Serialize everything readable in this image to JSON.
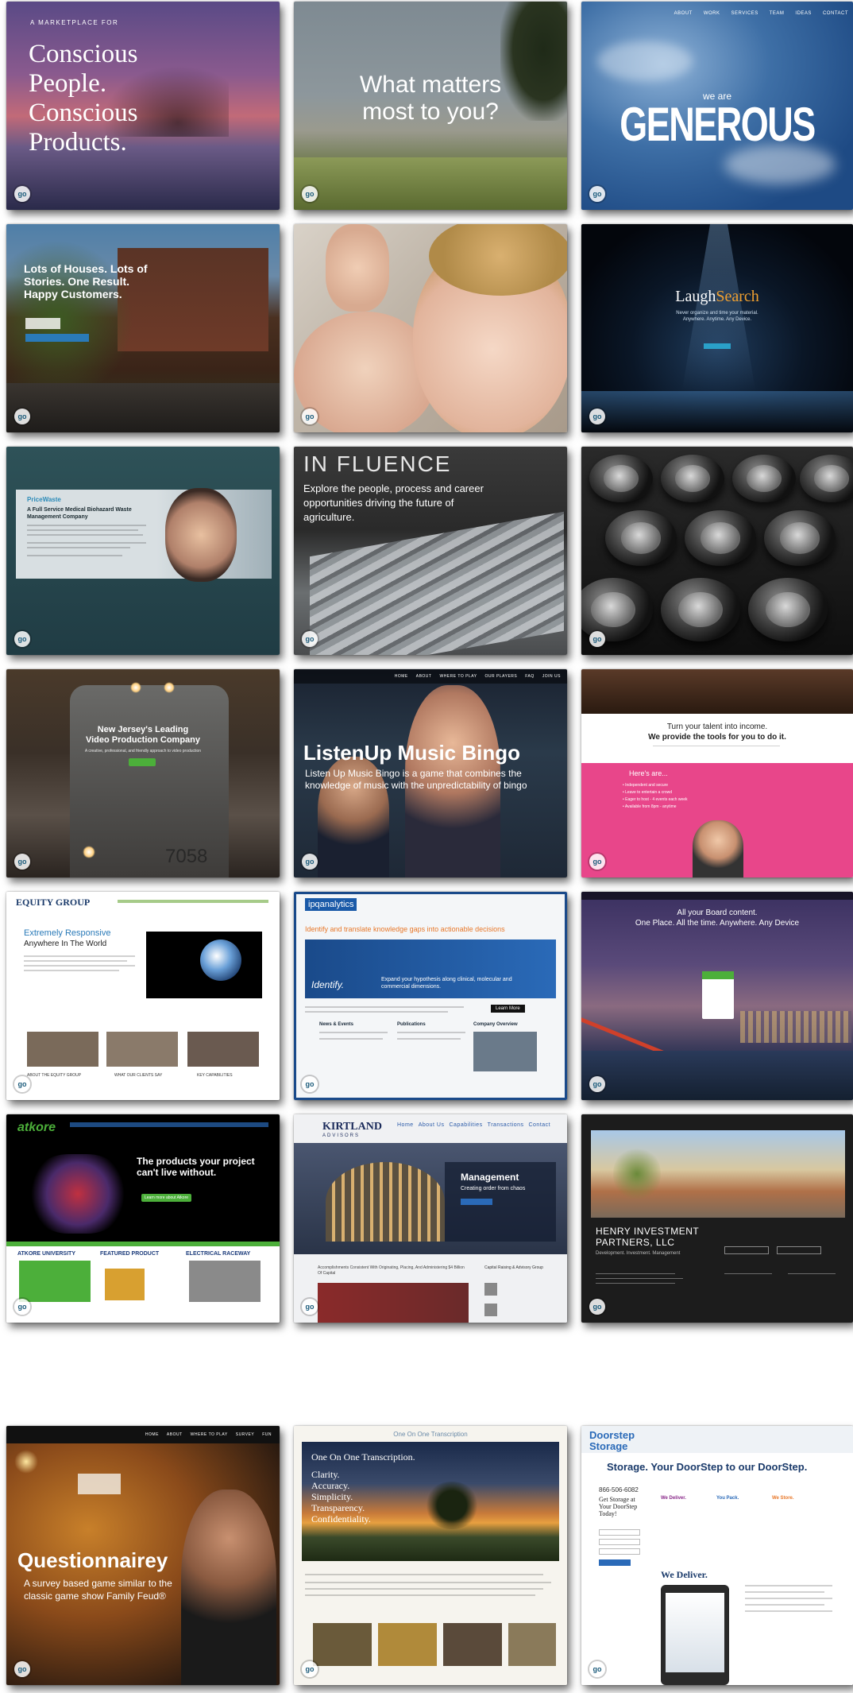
{
  "tiles": [
    {
      "kicker": "A MARKETPLACE FOR",
      "lines": [
        "Conscious",
        "People.",
        "Conscious",
        "Products."
      ]
    },
    {
      "headline_1": "What matters",
      "headline_2": "most to you?"
    },
    {
      "nav": [
        "ABOUT",
        "WORK",
        "SERVICES",
        "TEAM",
        "IDEAS",
        "CONTACT"
      ],
      "we_are": "we are",
      "headline": "GENEROUS"
    },
    {
      "headline": "Lots of Houses. Lots of Stories. One Result. Happy Customers."
    },
    {},
    {
      "brand_left": "Laugh",
      "brand_right": "Search",
      "sub_1": "Never organize and time your material.",
      "sub_2": "Anywhere. Anytime. Any Device."
    },
    {
      "brand": "PriceWaste",
      "headline": "A Full Service Medical Biohazard Waste Management Company"
    },
    {
      "brand": "IN FLUENCE",
      "body": "Explore the people, process and career opportunities driving the future of agriculture."
    },
    {},
    {
      "headline_1": "New Jersey's Leading",
      "headline_2": "Video Production Company",
      "sub": "A creative, professional, and friendly approach to video production",
      "car_number": "7058"
    },
    {
      "nav": [
        "HOME",
        "ABOUT",
        "WHERE TO PLAY",
        "OUR PLAYERS",
        "FAQ",
        "JOIN US"
      ],
      "headline": "ListenUp Music Bingo",
      "body": "Listen Up Music Bingo is a game that combines the knowledge of music with the unpredictability of bingo"
    },
    {
      "headline_1": "Turn your talent into income.",
      "headline_2": "We provide the tools for you to do it.",
      "list_title": "Here's are...",
      "items": [
        "Independent and secure",
        "Leave to entertain a crowd",
        "Eager to host - 4 events each week",
        "Available from 8pm - anytime"
      ]
    },
    {
      "brand": "EQUITY GROUP",
      "tagline": "Extremely Responsive",
      "subtitle": "Anywhere In The World",
      "captions": [
        "ABOUT THE EQUITY GROUP",
        "WHAT OUR CLIENTS SAY",
        "KEY CAPABILITIES"
      ]
    },
    {
      "brand": "ipqanalytics",
      "headline": "Identify and translate knowledge gaps into actionable decisions",
      "hero_word": "Identify.",
      "hero_text": "Expand your hypothesis along clinical, molecular and commercial dimensions.",
      "cta": "Learn More",
      "cols": [
        "News & Events",
        "Publications",
        "Company Overview"
      ]
    },
    {
      "line_1": "All your Board content.",
      "line_2": "One Place. All the time. Anywhere. Any Device"
    },
    {
      "brand": "atkore",
      "headline": "The products your project can't live without.",
      "cta": "Learn more about Atkore",
      "cols": [
        "ATKORE UNIVERSITY",
        "FEATURED PRODUCT",
        "ELECTRICAL RACEWAY"
      ]
    },
    {
      "brand": "KIRTLAND",
      "brand_sub": "ADVISORS",
      "nav": [
        "Home",
        "About Us",
        "Capabilities",
        "Transactions",
        "Contact"
      ],
      "box_title": "Management",
      "box_sub": "Creating order from chaos",
      "foot": "Accomplishments Consistent With Originating, Placing, And Administering $4 Billion Of Capital",
      "side_title": "Capital Raising & Advisory Group"
    },
    {
      "brand_1": "HENRY INVESTMENT",
      "brand_2": "PARTNERS, LLC",
      "sub": "Development. Investment. Management"
    },
    {
      "nav": [
        "HOME",
        "ABOUT",
        "WHERE TO PLAY",
        "SURVEY",
        "FUN"
      ],
      "headline": "Questionnairey",
      "body": "A survey based game similar to the classic game show Family Feud®"
    },
    {
      "top": "One On One Transcription",
      "hero_title": "One On One Transcription.",
      "hero_list": [
        "Clarity.",
        "Accuracy.",
        "Simplicity.",
        "Transparency.",
        "Confidentiality."
      ]
    },
    {
      "brand_1": "Doorstep",
      "brand_2": "Storage",
      "tagline": "Storage. Your DoorStep to our DoorStep.",
      "phone": "866-506-6082",
      "lead": "Get Storage at Your DoorStep Today!",
      "steps": [
        "We Deliver.",
        "You Pack.",
        "We Store."
      ],
      "deliver": "We Deliver."
    }
  ],
  "badge_label": "go"
}
